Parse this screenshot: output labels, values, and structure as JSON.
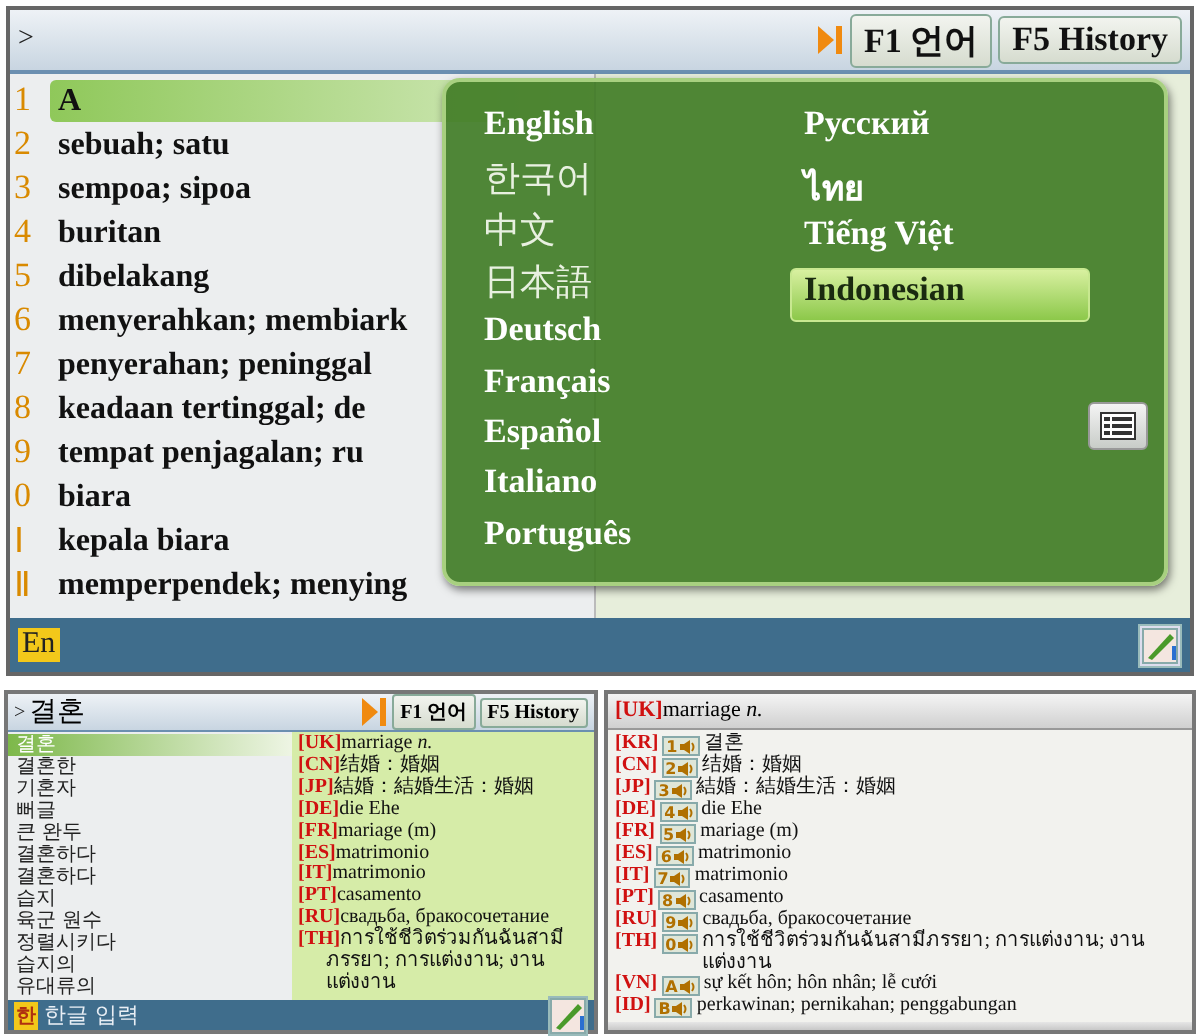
{
  "main": {
    "prompt": ">",
    "buttons": [
      "F1 언어",
      "F5 History"
    ],
    "results": [
      {
        "index": "1",
        "word": "A",
        "selected": true
      },
      {
        "index": "2",
        "word": "sebuah; satu",
        "selected": false
      },
      {
        "index": "3",
        "word": "sempoa; sipoa",
        "selected": false
      },
      {
        "index": "4",
        "word": "buritan",
        "selected": false
      },
      {
        "index": "5",
        "word": "dibelakang",
        "selected": false
      },
      {
        "index": "6",
        "word": "menyerahkan; membiark",
        "selected": false
      },
      {
        "index": "7",
        "word": "penyerahan; peninggal",
        "selected": false
      },
      {
        "index": "8",
        "word": "keadaan tertinggal; de",
        "selected": false
      },
      {
        "index": "9",
        "word": "tempat penjagalan; ru",
        "selected": false
      },
      {
        "index": "0",
        "word": "biara",
        "selected": false
      },
      {
        "index": "Ⅰ",
        "word": "kepala biara",
        "selected": false
      },
      {
        "index": "Ⅱ",
        "word": "memperpendek; menying",
        "selected": false
      }
    ],
    "language_menu": {
      "columns": [
        [
          {
            "label": "English",
            "selected": false
          },
          {
            "label": "한국어",
            "selected": false
          },
          {
            "label": "中文",
            "selected": false
          },
          {
            "label": "日本語",
            "selected": false
          },
          {
            "label": "Deutsch",
            "selected": false
          },
          {
            "label": "Français",
            "selected": false
          },
          {
            "label": "Español",
            "selected": false
          },
          {
            "label": "Italiano",
            "selected": false
          },
          {
            "label": "Português",
            "selected": false
          }
        ],
        [
          {
            "label": "Русский",
            "selected": false
          },
          {
            "label": "ไทย",
            "selected": false
          },
          {
            "label": "Tiếng Việt",
            "selected": false
          },
          {
            "label": "Indonesian",
            "selected": true
          }
        ]
      ]
    },
    "input_mode": "En"
  },
  "lower_left": {
    "prompt": ">",
    "search": {
      "value": "결혼"
    },
    "buttons": [
      "F1 언어",
      "F5 History"
    ],
    "words": [
      {
        "label": "결혼",
        "selected": true
      },
      {
        "label": "결혼한",
        "selected": false
      },
      {
        "label": "기혼자",
        "selected": false
      },
      {
        "label": "뻐글",
        "selected": false
      },
      {
        "label": "큰 완두",
        "selected": false
      },
      {
        "label": "결혼하다",
        "selected": false
      },
      {
        "label": "결혼하다",
        "selected": false
      },
      {
        "label": "습지",
        "selected": false
      },
      {
        "label": "육군 원수",
        "selected": false
      },
      {
        "label": "정렬시키다",
        "selected": false
      },
      {
        "label": "습지의",
        "selected": false
      },
      {
        "label": "유대류의",
        "selected": false
      }
    ],
    "definitions": [
      {
        "code": "[UK]",
        "text": "marriage *n.*"
      },
      {
        "code": "[CN]",
        "text": "结婚：婚姻"
      },
      {
        "code": "[JP]",
        "text": "結婚：結婚生活：婚姻"
      },
      {
        "code": "[DE]",
        "text": "die Ehe"
      },
      {
        "code": "[FR]",
        "text": "mariage (m)"
      },
      {
        "code": "[ES]",
        "text": "matrimonio"
      },
      {
        "code": "[IT]",
        "text": "matrimonio"
      },
      {
        "code": "[PT]",
        "text": "casamento"
      },
      {
        "code": "[RU]",
        "text": "свадьба, бракосочетание"
      },
      {
        "code": "[TH]",
        "text": "การใช้ชีวิตร่วมกันฉันสามีภรรยา; การแต่งงาน; งานแต่งงาน"
      }
    ],
    "input_mode": {
      "badge": "한",
      "label": "한글 입력"
    }
  },
  "lower_right": {
    "title": {
      "code": "[UK]",
      "text": "marriage *n.*"
    },
    "rows": [
      {
        "code": "[KR]",
        "index": "1",
        "text": "결혼"
      },
      {
        "code": "[CN]",
        "index": "2",
        "text": "结婚：婚姻"
      },
      {
        "code": "[JP]",
        "index": "3",
        "text": "結婚：結婚生活：婚姻"
      },
      {
        "code": "[DE]",
        "index": "4",
        "text": "die Ehe"
      },
      {
        "code": "[FR]",
        "index": "5",
        "text": "mariage (m)"
      },
      {
        "code": "[ES]",
        "index": "6",
        "text": "matrimonio"
      },
      {
        "code": "[IT]",
        "index": "7",
        "text": "matrimonio"
      },
      {
        "code": "[PT]",
        "index": "8",
        "text": "casamento"
      },
      {
        "code": "[RU]",
        "index": "9",
        "text": "свадьба, бракосочетание"
      },
      {
        "code": "[TH]",
        "index": "0",
        "text": "การใช้ชีวิตร่วมกันฉันสามีภรรยา; การแต่งงาน; งานแต่งงาน"
      },
      {
        "code": "[VN]",
        "index": "A",
        "text": "sự kết hôn; hôn nhân; lễ cưới"
      },
      {
        "code": "[ID]",
        "index": "B",
        "text": "perkawinan; pernikahan; penggabungan"
      }
    ]
  }
}
